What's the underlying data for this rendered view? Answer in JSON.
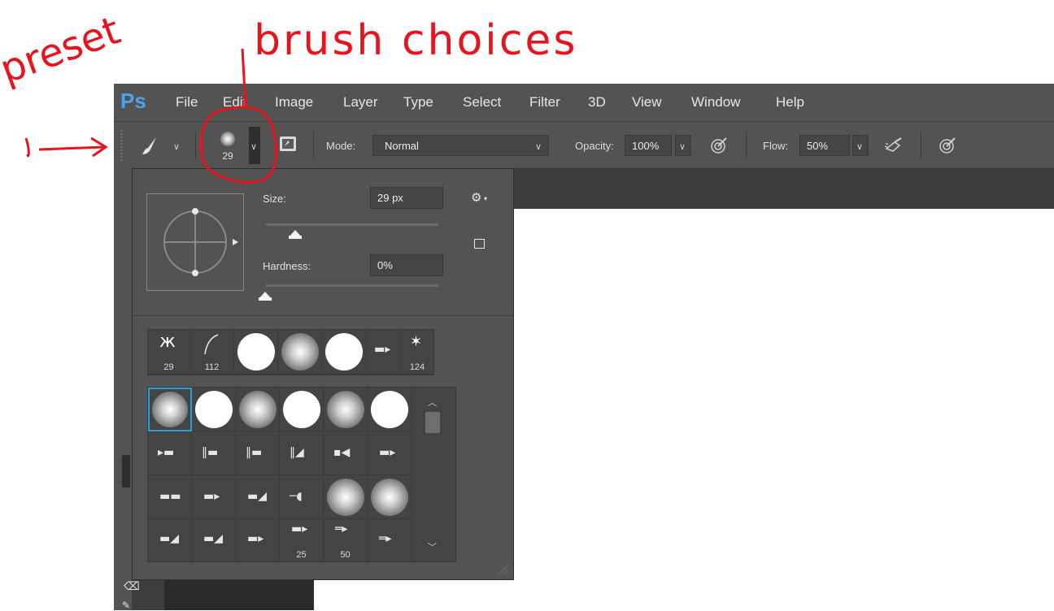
{
  "annotations": {
    "preset": "preset",
    "brush_choices": "brush choices",
    "color": "#e8141d"
  },
  "app": {
    "logo": "Ps",
    "menu": [
      "File",
      "Edit",
      "Image",
      "Layer",
      "Type",
      "Select",
      "Filter",
      "3D",
      "View",
      "Window",
      "Help"
    ]
  },
  "options_bar": {
    "brush_size_preview": "29",
    "mode_label": "Mode:",
    "mode_value": "Normal",
    "opacity_label": "Opacity:",
    "opacity_value": "100%",
    "flow_label": "Flow:",
    "flow_value": "50%"
  },
  "brush_panel": {
    "size_label": "Size:",
    "size_value": "29 px",
    "size_slider": 0.13,
    "hardness_label": "Hardness:",
    "hardness_value": "0%",
    "hardness_slider": 0.0,
    "recent_brushes": [
      "29",
      "112",
      "",
      "",
      "",
      "",
      "124"
    ],
    "grid_labels": [
      "25",
      "50"
    ]
  }
}
